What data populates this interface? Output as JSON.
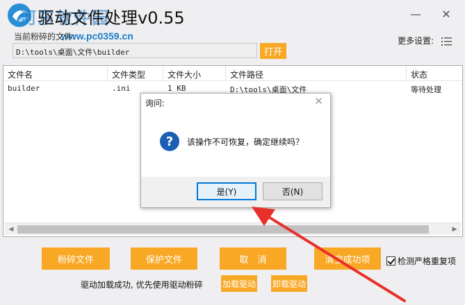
{
  "window": {
    "title": "驱动文件处理v0.55",
    "minimize_symbol": "—",
    "close_symbol": "✕"
  },
  "watermark": {
    "text": "河东软件园",
    "url": "www.pc0359.cn"
  },
  "path_section": {
    "label": "当前粉碎的文件:",
    "value": "D:\\tools\\桌面\\文件\\builder",
    "open_button": "打开"
  },
  "more_settings": {
    "label": "更多设置:"
  },
  "table": {
    "columns": [
      "文件名",
      "文件类型",
      "文件大小",
      "文件路径",
      "状态"
    ],
    "rows": [
      {
        "name": "builder",
        "type": ".ini",
        "size": "1  KB",
        "path": "D:\\tools\\桌面\\文件",
        "status": "等待处理"
      }
    ]
  },
  "dialog": {
    "title": "询问:",
    "message": "该操作不可恢复，确定继续吗？",
    "yes_button": "是(Y)",
    "no_button": "否(N)"
  },
  "actions": {
    "shred": "粉碎文件",
    "protect": "保护文件",
    "cancel": "取　消",
    "clear_success": "清空成功项",
    "load_driver": "加载驱动",
    "unload_driver": "卸载驱动"
  },
  "options": {
    "check_duplicates": "检测严格重复项",
    "check_duplicates_checked": true
  },
  "status": {
    "message": "驱动加载成功, 优先使用驱动粉碎"
  },
  "colors": {
    "accent_orange": "#f9a825",
    "dialog_focus_blue": "#0078d7",
    "arrow_red": "#e8302a"
  }
}
